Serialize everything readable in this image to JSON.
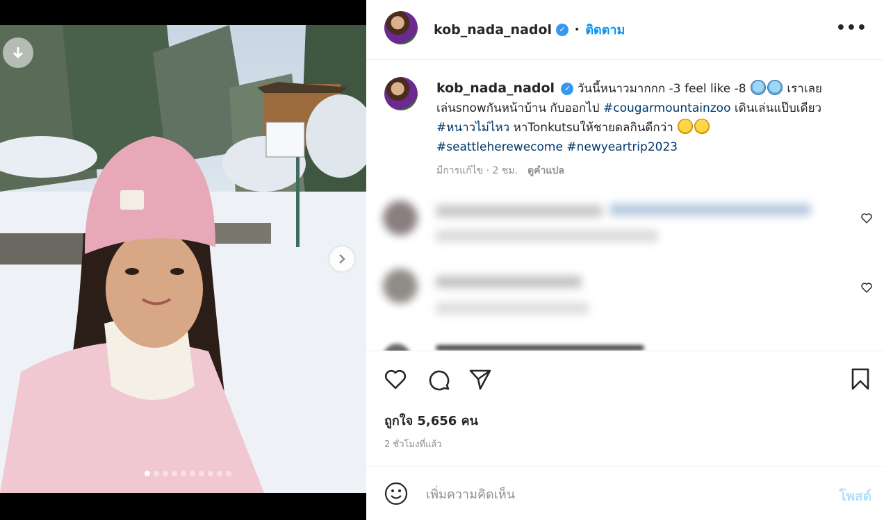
{
  "post": {
    "username": "kob_nada_nadol",
    "follow_label": "ติดตาม",
    "more_icon": "more-horizontal-icon",
    "carousel": {
      "slide_count": 10,
      "active_index": 0
    },
    "caption": {
      "text_1": "วันนี้หนาวมากกก -3 feel like -8",
      "text_2": "เราเลยเล่นsnowกันหน้าบ้าน กับออกไป",
      "tag_1": "#cougarmountainzoo",
      "text_3": "เดินเล่นแป๊บเดียว",
      "tag_2": "#หนาวไม่ไหว",
      "text_4": "หาTonkutsuให้ชายดลกินดีกว่า",
      "tag_3": "#seattleherewecome",
      "tag_4": "#newyeartrip2023",
      "emoji_cold": "cold-face-emoji",
      "emoji_yum": "yum-face-emoji"
    },
    "meta": {
      "edited": "มีการแก้ไข · 2 ชม.",
      "translate": "ดูคำแปล"
    },
    "likes": "ถูกใจ 5,656 คน",
    "time_ago": "2 ชั่วโมงที่แล้ว",
    "comment_placeholder": "เพิ่มความคิดเห็น",
    "post_label": "โพสต์",
    "colors": {
      "accent": "#0095f6",
      "link": "#00376b",
      "muted": "#8e8e8e",
      "post_disabled": "#b2dffc"
    }
  }
}
